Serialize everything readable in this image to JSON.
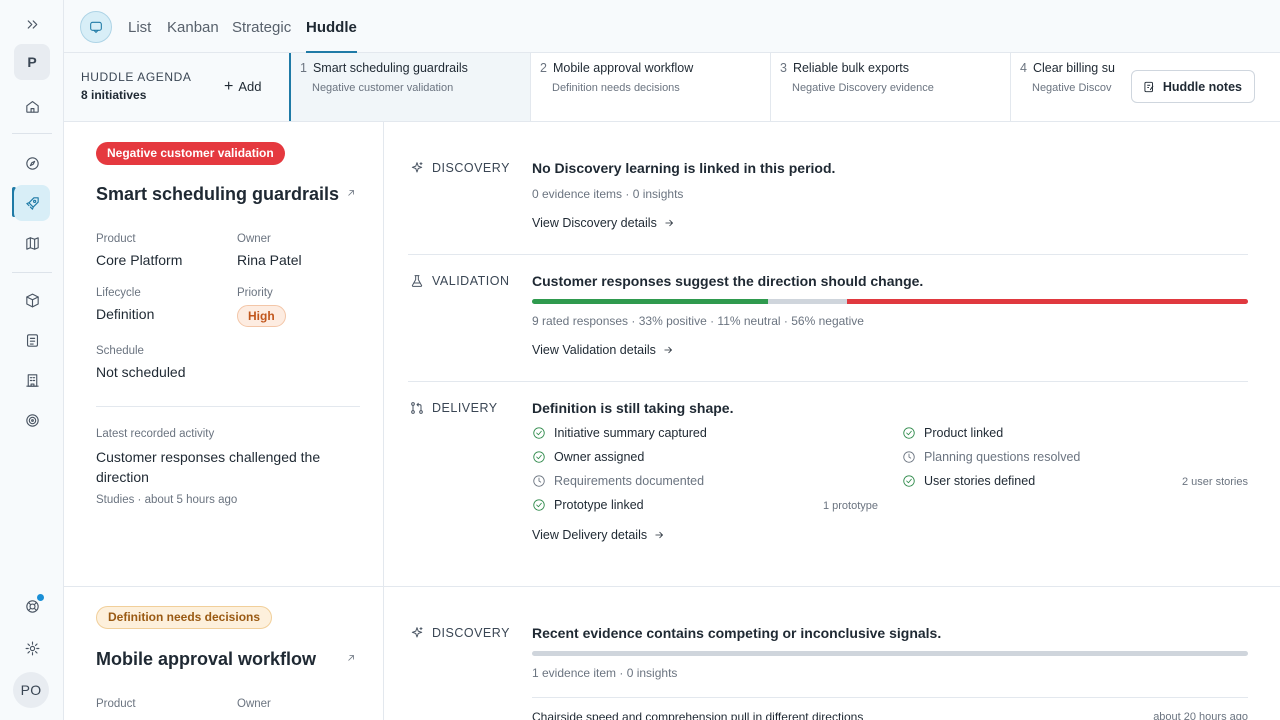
{
  "rail": {
    "workspace_initial": "P",
    "user_initials": "PO"
  },
  "topbar": {
    "tabs": [
      {
        "label": "List"
      },
      {
        "label": "Kanban"
      },
      {
        "label": "Strategic"
      },
      {
        "label": "Huddle",
        "selected": true
      }
    ]
  },
  "agenda": {
    "title": "HUDDLE AGENDA",
    "count": "8 initiatives",
    "add_label": "Add",
    "notes_label": "Huddle notes",
    "items": [
      {
        "num": "1",
        "title": "Smart scheduling guardrails",
        "status": "Negative customer validation"
      },
      {
        "num": "2",
        "title": "Mobile approval workflow",
        "status": "Definition needs decisions"
      },
      {
        "num": "3",
        "title": "Reliable bulk exports",
        "status": "Negative Discovery evidence"
      },
      {
        "num": "4",
        "title": "Clear billing su",
        "status": "Negative Discov"
      }
    ]
  },
  "card1": {
    "status_pill": "Negative customer validation",
    "title": "Smart scheduling guardrails",
    "product_label": "Product",
    "product": "Core Platform",
    "owner_label": "Owner",
    "owner": "Rina Patel",
    "lifecycle_label": "Lifecycle",
    "lifecycle": "Definition",
    "priority_label": "Priority",
    "priority": "High",
    "schedule_label": "Schedule",
    "schedule": "Not scheduled",
    "latest_label": "Latest recorded activity",
    "latest_text": "Customer responses challenged the direction",
    "latest_meta": "Studies · about 5 hours ago",
    "discovery": {
      "label": "DISCOVERY",
      "headline": "No Discovery learning is linked in this period.",
      "sub": "0 evidence items · 0 insights",
      "link": "View Discovery details"
    },
    "validation": {
      "label": "VALIDATION",
      "headline": "Customer responses suggest the direction should change.",
      "sub": "9 rated responses · 33% positive · 11% neutral · 56% negative",
      "link": "View Validation details",
      "positive": 33,
      "neutral": 11,
      "negative": 56,
      "positive_color": "#2f9a4e",
      "neutral_color": "#cfd5dc",
      "negative_color": "#e0393f"
    },
    "delivery": {
      "label": "DELIVERY",
      "headline": "Definition is still taking shape.",
      "link": "View Delivery details",
      "checklist": [
        {
          "label": "Initiative summary captured",
          "done": true,
          "meta": ""
        },
        {
          "label": "Product linked",
          "done": true,
          "meta": ""
        },
        {
          "label": "Owner assigned",
          "done": true,
          "meta": ""
        },
        {
          "label": "Planning questions resolved",
          "done": false,
          "meta": ""
        },
        {
          "label": "Requirements documented",
          "done": false,
          "meta": ""
        },
        {
          "label": "User stories defined",
          "done": true,
          "meta": "2 user stories"
        },
        {
          "label": "Prototype linked",
          "done": true,
          "meta": "1 prototype"
        }
      ]
    }
  },
  "card2": {
    "status_pill": "Definition needs decisions",
    "title": "Mobile approval workflow",
    "product_label": "Product",
    "owner_label": "Owner",
    "discovery": {
      "label": "DISCOVERY",
      "headline": "Recent evidence contains competing or inconclusive signals.",
      "sub": "1 evidence item · 0 insights",
      "evidence_title": "Chairside speed and comprehension pull in different directions",
      "evidence_time": "about 20 hours ago"
    }
  }
}
